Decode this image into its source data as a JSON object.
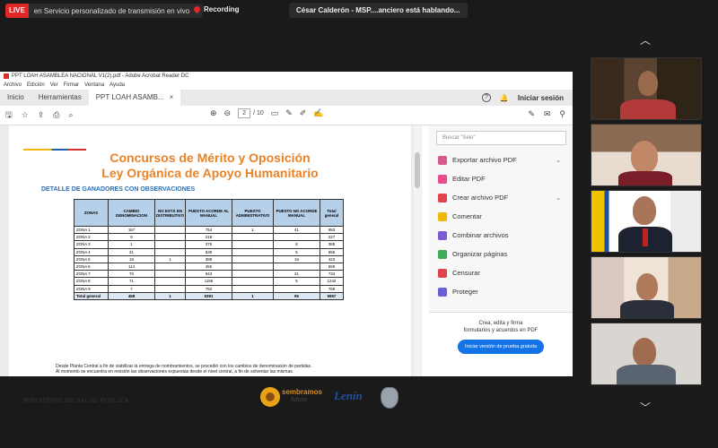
{
  "topbar": {
    "live_badge": "LIVE",
    "live_text": "en Servicio personalizado de transmisión en vivo",
    "live_caret": "▾",
    "recording": "Recording",
    "speaking": "César Calderón - MSP....anciero está hablando..."
  },
  "app": {
    "title": "PPT LOAH ASAMBLEA NACIONAL V1(2).pdf - Adobe Acrobat Reader DC",
    "menu": [
      "Archivo",
      "Edición",
      "Ver",
      "Firmar",
      "Ventana",
      "Ayuda"
    ],
    "tabs": [
      "Inicio",
      "Herramientas",
      "PPT LOAH ASAMB..."
    ],
    "tab_close": "×",
    "help_icon": "?",
    "signin": "Iniciar sesión",
    "page_current": "2",
    "page_total": "/ 10"
  },
  "slide": {
    "title_line1": "Concursos de Mérito y Oposición",
    "title_line2": "Ley Orgánica de Apoyo Humanitario",
    "subhead": "DETALLE DE GANADORES CON OBSERVACIONES",
    "headers": [
      "ZONAS",
      "CAMBIO DENOMINACION",
      "NO ESTÁ EN DISTRIBUTIVO",
      "PUESTO ACORDE AL MANUAL",
      "PUESTO ADMINISTRATIVO",
      "PUESTO NO ACORDE MANUAL",
      "Total general"
    ],
    "rows": [
      [
        "ZONA 1",
        "157",
        "",
        "754",
        "1",
        "41",
        "953"
      ],
      [
        "ZONA 2",
        "9",
        "",
        "218",
        "",
        "",
        "227"
      ],
      [
        "ZONA 3",
        "1",
        "",
        "376",
        "",
        "8",
        "385"
      ],
      [
        "ZONA 4",
        "21",
        "",
        "639",
        "",
        "5",
        "665"
      ],
      [
        "ZONA 5",
        "18",
        "1",
        "388",
        "",
        "16",
        "423"
      ],
      [
        "ZONA 6",
        "114",
        "",
        "455",
        "",
        "",
        "569"
      ],
      [
        "ZONA 7",
        "70",
        "",
        "643",
        "",
        "21",
        "734"
      ],
      [
        "ZONA 8",
        "71",
        "",
        "1166",
        "",
        "5",
        "1242"
      ],
      [
        "ZONA 9",
        "7",
        "",
        "752",
        "",
        "",
        "759"
      ]
    ],
    "total": [
      "Total general",
      "468",
      "1",
      "5391",
      "1",
      "96",
      "5957"
    ],
    "note_line1": "Desde Planta Central a fin de viabilizar la entrega de nombramientos, se procedió con los cambios de denominación de partidas.",
    "note_line2": "Al momento se encuentra en revisión las observaciones expuestas desde el nivel central, a fin de solventar las mismas.",
    "ministry": "MINISTERIO DE SALUD PÚBLICA",
    "logo_sembramos": "sembramos",
    "logo_futuro": "futuro",
    "logo_lenin": "Lenín"
  },
  "sidepanel": {
    "search_placeholder": "Buscar \"Selo\"",
    "tools": [
      {
        "label": "Exportar archivo PDF",
        "color": "#d65a8f",
        "caret": "⌄"
      },
      {
        "label": "Editar PDF",
        "color": "#e84c8b",
        "caret": ""
      },
      {
        "label": "Crear archivo PDF",
        "color": "#e0444a",
        "caret": "⌄"
      },
      {
        "label": "Comentar",
        "color": "#f2b705",
        "caret": ""
      },
      {
        "label": "Combinar archivos",
        "color": "#7b5cd6",
        "caret": ""
      },
      {
        "label": "Organizar páginas",
        "color": "#3eab5b",
        "caret": ""
      },
      {
        "label": "Censurar",
        "color": "#e0444a",
        "caret": ""
      },
      {
        "label": "Proteger",
        "color": "#6a5fd6",
        "caret": ""
      }
    ],
    "promo_line1": "Crea, edita y firma",
    "promo_line2": "formularios y acuerdos en PDF",
    "promo_button": "Iniciar versión de prueba gratuita"
  },
  "gallery": {
    "up_arrow": "︿",
    "down_arrow": "﹀"
  }
}
